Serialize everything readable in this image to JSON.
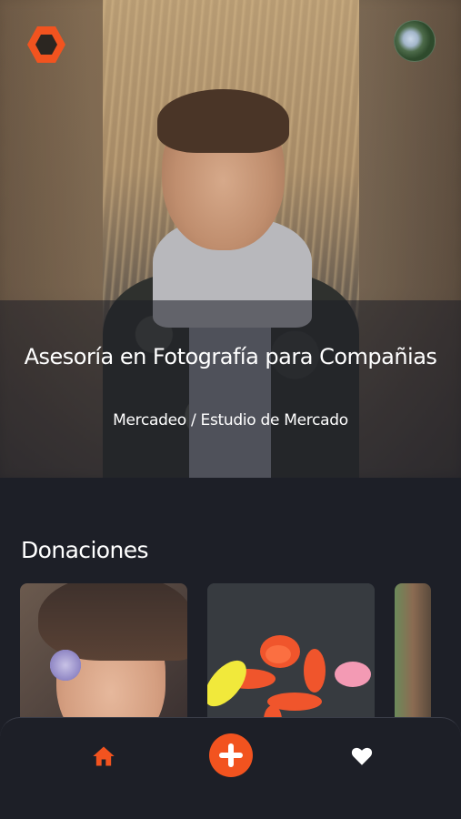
{
  "app": {
    "accent_color": "#f2531f",
    "background_color": "#1d1f27"
  },
  "header": {
    "logo_icon": "hexagon-logo-icon",
    "avatar_icon": "avatar-icon"
  },
  "hero": {
    "title": "Asesoría en Fotografía para Compañias",
    "subtitle": "Mercadeo / Estudio de Mercado"
  },
  "donations": {
    "title": "Donaciones",
    "cards": [
      {
        "image": "portrait-with-flowers"
      },
      {
        "image": "balloon-dog"
      },
      {
        "image": "partial-card"
      }
    ]
  },
  "bottom_nav": {
    "items": [
      {
        "icon": "home-icon",
        "color": "#f2531f"
      },
      {
        "icon": "plus-icon",
        "color": "#ffffff",
        "background": "#f2531f"
      },
      {
        "icon": "heart-icon",
        "color": "#ffffff"
      }
    ]
  }
}
